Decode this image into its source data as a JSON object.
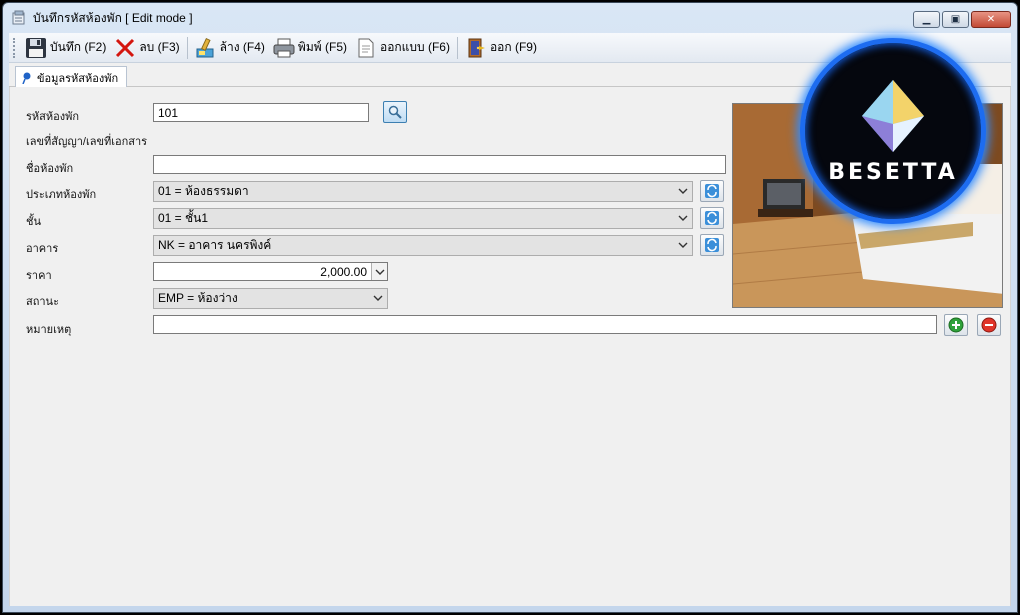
{
  "window": {
    "title": "บันทึกรหัสห้องพัก [ Edit mode ]",
    "minimize_symbol": "▁",
    "restore_symbol": "▣",
    "close_symbol": "✕"
  },
  "toolbar": {
    "save_label": "บันทึก (F2)",
    "delete_label": "ลบ (F3)",
    "clear_label": "ล้าง (F4)",
    "print_label": "พิมพ์ (F5)",
    "design_label": "ออกแบบ (F6)",
    "exit_label": "ออก (F9)"
  },
  "tabs": [
    {
      "label": "ข้อมูลรหัสห้องพัก"
    }
  ],
  "form": {
    "room_code": {
      "label": "รหัสห้องพัก",
      "value": "101"
    },
    "contract_label": "เลขที่สัญญา/เลขที่เอกสาร",
    "room_name": {
      "label": "ชื่อห้องพัก",
      "value": ""
    },
    "room_type": {
      "label": "ประเภทห้องพัก",
      "value": "01 = ห้องธรรมดา"
    },
    "floor": {
      "label": "ชั้น",
      "value": "01 = ชั้น1"
    },
    "building": {
      "label": "อาคาร",
      "value": "NK = อาคาร นครพิงค์"
    },
    "price": {
      "label": "ราคา",
      "value": "2,000.00"
    },
    "status": {
      "label": "สถานะ",
      "value": "EMP = ห้องว่าง"
    },
    "note": {
      "label": "หมายเหตุ",
      "value": ""
    }
  },
  "logo": {
    "text": "BESETTA"
  },
  "colors": {
    "accent": "#1d6cf0",
    "titlebar": "#c4d6ec",
    "panel": "#f0f0f0"
  }
}
